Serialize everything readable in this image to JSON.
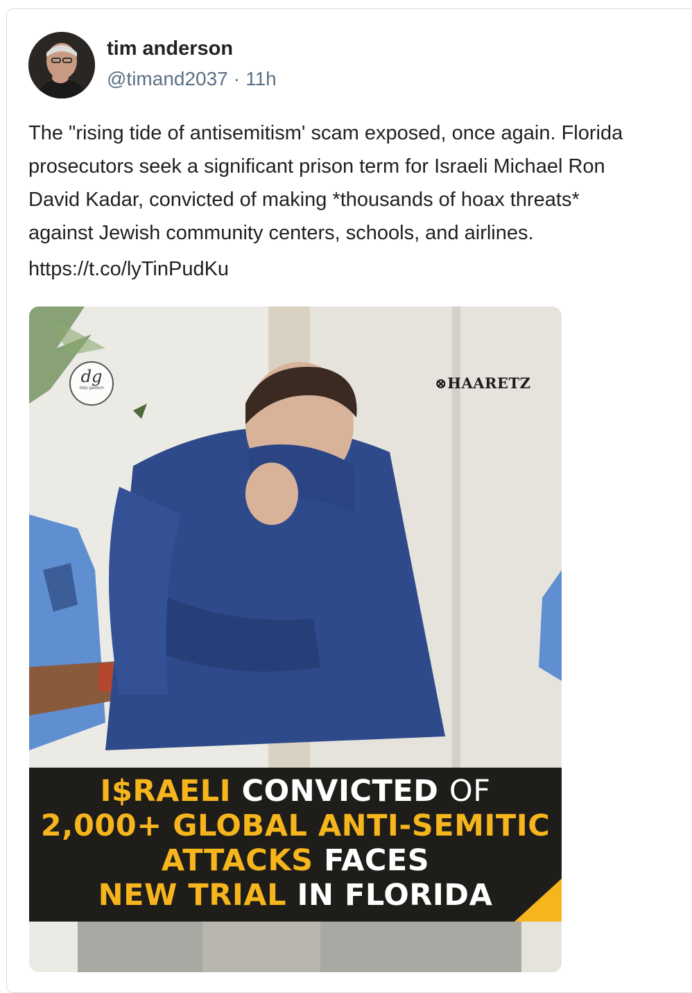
{
  "author": {
    "name": "tim anderson",
    "handle": "@timand2037",
    "separator": "·",
    "time": "11h"
  },
  "tweet": {
    "lines": [
      "The \"rising tide of antisemitism' scam exposed, once again. Florida",
      "prosecutors seek a significant prison term for Israeli Michael Ron",
      "David Kadar, convicted of making *thousands of hoax threats*",
      "against Jewish community centers, schools, and airlines."
    ],
    "link": "https://t.co/lyTinPudKu"
  },
  "media": {
    "watermark": "HAARETZ",
    "badge": "dg",
    "badge_small": "daily gaideon",
    "headline": {
      "line1_a": "I$RAELI",
      "line1_b": "CONVICTED",
      "line1_c": "OF",
      "line2": "2,000+ GLOBAL ANTI-SEMITIC",
      "line3_a": "ATTACKS",
      "line3_b": "FACES",
      "line4_a": "NEW TRIAL",
      "line4_b": "IN FLORIDA"
    },
    "colors": {
      "accent_yellow": "#f6b51d",
      "banner_bg": "#1f1d1a",
      "sweater_blue": "#2f4a8a"
    }
  }
}
